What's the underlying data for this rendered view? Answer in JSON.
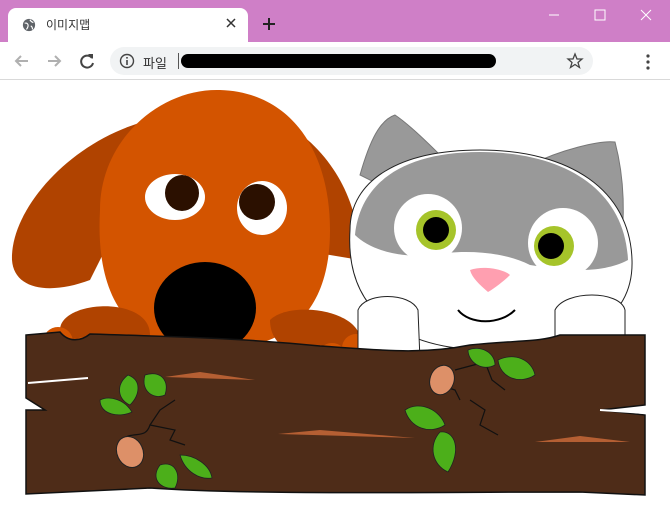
{
  "tab": {
    "title": "이미지맵",
    "favicon": "globe-icon"
  },
  "window": {
    "buttons": [
      "minimize-icon",
      "maximize-icon",
      "close-icon"
    ]
  },
  "toolbar": {
    "address_prefix": "파일",
    "icons": [
      "back-arrow-icon",
      "forward-arrow-icon",
      "reload-icon",
      "info-icon",
      "star-icon",
      "more-menu-icon"
    ]
  },
  "colors": {
    "tabbar": "#cf7fc7",
    "dog_body": "#d35400",
    "dog_ear": "#b04300",
    "cat_gray": "#999999",
    "log_brown": "#4e2c18",
    "leaf_green": "#4caf1a",
    "seed_tan": "#dd9068"
  },
  "scene": {
    "description_icons": [
      "dog-illustration",
      "cat-illustration",
      "log-illustration"
    ]
  }
}
